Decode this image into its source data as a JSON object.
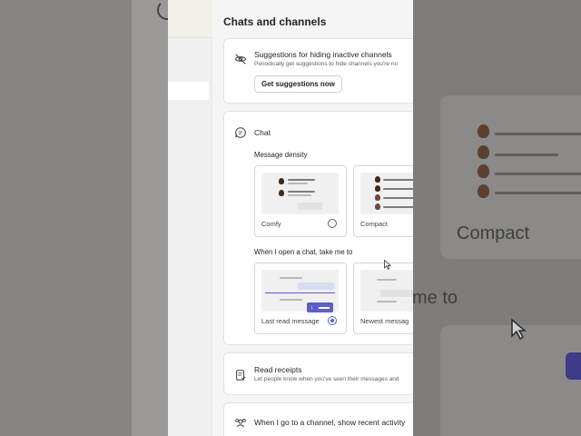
{
  "panel": {
    "title": "Chats and channels"
  },
  "suggestions": {
    "title": "Suggestions for hiding inactive channels",
    "description": "Periodically get suggestions to hide channels you're no",
    "button": "Get suggestions now",
    "icon": "eye-off-icon"
  },
  "chat": {
    "title": "Chat",
    "icon": "chat-bubble-icon",
    "density_label": "Message density",
    "density_options": [
      {
        "label": "Comfy",
        "selected": false
      },
      {
        "label": "Compact",
        "selected": false
      }
    ],
    "open_label": "When I open a chat, take me to",
    "open_options": [
      {
        "label": "Last read message",
        "selected": true
      },
      {
        "label": "Newest messag",
        "selected": false
      }
    ]
  },
  "read_receipts": {
    "title": "Read receipts",
    "description": "Let people know when you've seen their messages and",
    "icon": "read-receipt-icon"
  },
  "channel_activity": {
    "title": "When I go to a channel, show recent activity",
    "icon": "channel-activity-icon"
  },
  "background": {
    "compact_label": "Compact",
    "me_to_label": "me to"
  },
  "colors": {
    "accent": "#5b5fc7",
    "panel_bg": "#f5f5f5",
    "card_bg": "#ffffff"
  }
}
